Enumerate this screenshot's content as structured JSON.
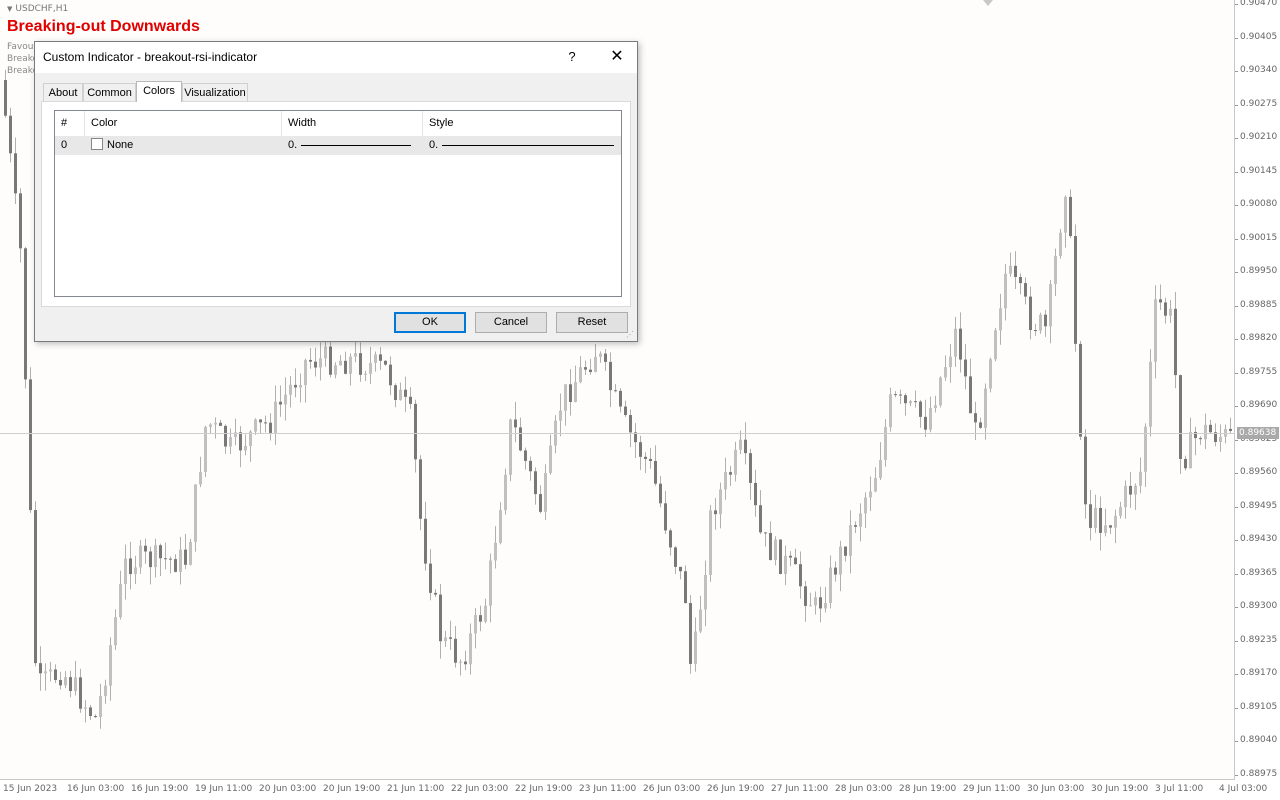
{
  "chart": {
    "symbol": "USDCHF,H1",
    "headline": "Breaking-out Downwards",
    "indicator_lines": [
      "Favou",
      "Breako",
      "Breako"
    ],
    "current_price": "0.89638",
    "price_ticks": [
      "0.90470",
      "0.90405",
      "0.90340",
      "0.90275",
      "0.90210",
      "0.90145",
      "0.90080",
      "0.90015",
      "0.89950",
      "0.89885",
      "0.89820",
      "0.89755",
      "0.89690",
      "0.89625",
      "0.89560",
      "0.89495",
      "0.89430",
      "0.89365",
      "0.89300",
      "0.89235",
      "0.89170",
      "0.89105",
      "0.89040",
      "0.88975"
    ],
    "time_ticks": [
      "15 Jun 2023",
      "16 Jun 03:00",
      "16 Jun 19:00",
      "19 Jun 11:00",
      "20 Jun 03:00",
      "20 Jun 19:00",
      "21 Jun 11:00",
      "22 Jun 03:00",
      "22 Jun 19:00",
      "23 Jun 11:00",
      "26 Jun 03:00",
      "26 Jun 19:00",
      "27 Jun 11:00",
      "28 Jun 03:00",
      "28 Jun 19:00",
      "29 Jun 11:00",
      "30 Jun 03:00",
      "30 Jun 19:00",
      "3 Jul 11:00",
      "4 Jul 03:00"
    ],
    "colors": {
      "bull": "#c0c0c0",
      "bear": "#787878",
      "wick": "#b0b0b0"
    }
  },
  "dialog": {
    "title": "Custom Indicator - breakout-rsi-indicator",
    "help_label": "?",
    "close_label": "✕",
    "tabs": [
      "About",
      "Common",
      "Colors",
      "Visualization"
    ],
    "active_tab": "Colors",
    "columns": [
      "#",
      "Color",
      "Width",
      "Style"
    ],
    "rows": [
      {
        "index": "0",
        "color": "None",
        "width": "0.",
        "style": "0."
      }
    ],
    "buttons": {
      "ok": "OK",
      "cancel": "Cancel",
      "reset": "Reset"
    },
    "accent": "#0078d7"
  }
}
